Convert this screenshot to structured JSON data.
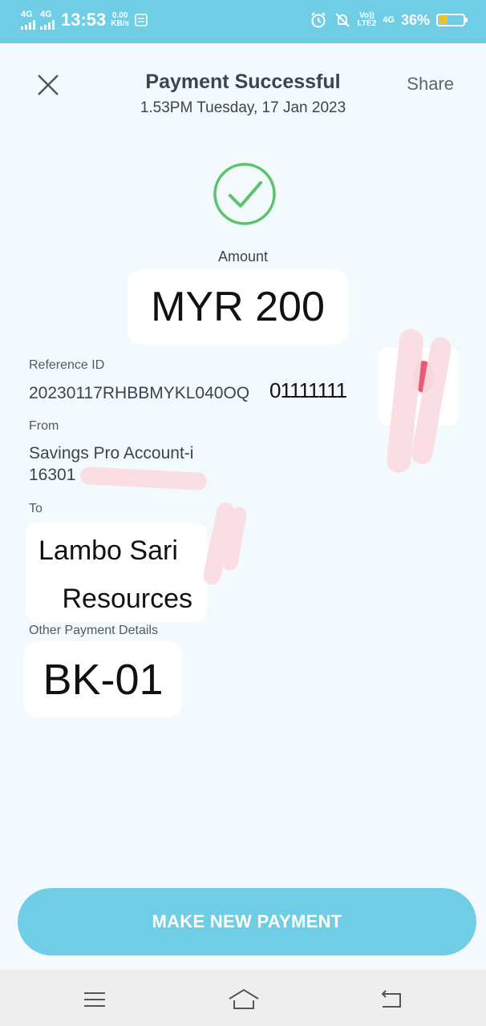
{
  "status_bar": {
    "network1": "4G",
    "network2": "4G",
    "time": "13:53",
    "speed_value": "0.00",
    "speed_unit": "KB/s",
    "volte": "Vo))",
    "lte": "LTE2",
    "sim_net": "4G",
    "battery_pct": "36%",
    "battery_level": 0.36,
    "accent": "#6fcde6"
  },
  "header": {
    "title": "Payment Successful",
    "subtitle": "1.53PM Tuesday, 17 Jan 2023",
    "share_label": "Share"
  },
  "amount": {
    "label": "Amount",
    "value": "MYR 200"
  },
  "reference": {
    "label": "Reference ID",
    "value": "20230117RHBBMYKL040OQ",
    "overlay": "01111111"
  },
  "from": {
    "label": "From",
    "account_name": "Savings Pro Account-i",
    "account_number": "16301"
  },
  "to": {
    "label": "To",
    "line1": "Lambo Sari",
    "line2": "Resources"
  },
  "other": {
    "label": "Other Payment Details",
    "value": "BK-01"
  },
  "actions": {
    "make_new_payment": "MAKE NEW PAYMENT"
  },
  "icons": {
    "success": "check-circle-icon",
    "close": "close-icon",
    "nav_menu": "menu-icon",
    "nav_home": "home-icon",
    "nav_back": "back-icon"
  },
  "colors": {
    "success_green": "#5cc36a",
    "button": "#6fcde6",
    "background": "#f3fafd"
  }
}
